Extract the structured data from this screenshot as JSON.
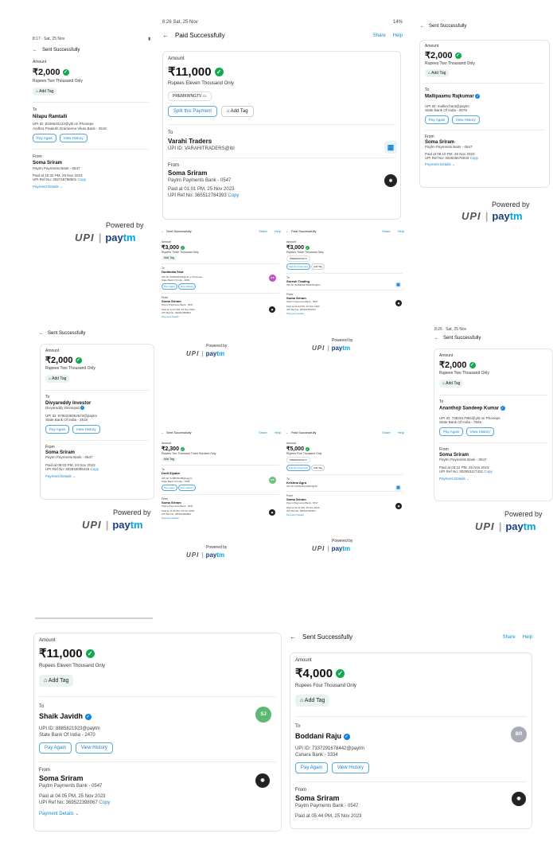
{
  "common": {
    "amount_label": "Amount",
    "to_label": "To",
    "from_label": "From",
    "add_tag": "Add Tag",
    "pay_again": "Pay Again",
    "view_history": "View History",
    "payment_details": "Payment Details",
    "share": "Share",
    "help": "Help",
    "sent_title": "Sent Successfully",
    "paid_title": "Paid Successfully",
    "powered_by": "Powered by",
    "upi": "UPI",
    "paytm_a": "pay",
    "paytm_b": "tm",
    "from_name": "Soma Sriram",
    "from_bank": "Paytm Payments Bank - 0547",
    "copy": "Copy"
  },
  "s1": {
    "status": "8:17 · Sat, 25 Nov",
    "amount": "₹2,000",
    "words": "Rupees Two Thousand Only",
    "to_name": "Nilapu Ramtalli",
    "upi": "UPI ID: 8106633123@ybl on Phonepe",
    "bank": "Andhra Pradesh Grameena Vikas Bank - 2518",
    "paid_at": "Paid at 10:32 PM, 25 Nov 2023",
    "ref": "UPI Ref No: 302748798501"
  },
  "s2": {
    "status_time": "8:26 Sat, 25 Nov",
    "status_right": "14%",
    "amount": "₹11,000",
    "words": "Rupees Eleven Thousand Only",
    "code": "PREMKWNGTV",
    "split": "Split this Payment",
    "to_name": "Varahi Traders",
    "upi": "UPI ID: VARAHITRADERS@ibl",
    "paid_at": "Paid at 01:01 PM, 25 Nov 2023",
    "ref": "UPI Ref No: 365512784393"
  },
  "s3": {
    "amount": "₹2,000",
    "words": "Rupees Two Thousand Only",
    "to_name": "Mallipaamu Rajkumar",
    "upi": "UPI ID: mallerchant@paytm",
    "bank": "State Bank Of India - 8078",
    "paid_at": "Paid at 08:10 PM, 25 Nov 2023",
    "ref": "UPI Ref No: 302846676033"
  },
  "s4": {
    "amount": "₹3,000",
    "words": "Rupees Three Thousand Only",
    "to_name": "Dudimala Siva",
    "av": "DS",
    "upi": "UPI ID: 6303845416@ybl on Phonepe",
    "bank": "State Bank Of India - 4830",
    "paid_at": "Paid at 12:27 PM, 25 Nov 2023",
    "ref": "UPI Ref No: 330921056804"
  },
  "s5": {
    "amount": "₹3,000",
    "words": "Rupees Three Thousand Only",
    "code": "PREMKWNGTV",
    "split": "Split this Payment",
    "to_name": "Suresh Trading",
    "upi": "UPI ID: SURESHTRADING@ibl",
    "paid_at": "Paid at 01:04 PM, 25 Nov 2023",
    "ref": "UPI Ref No: 365512784512"
  },
  "s6": {
    "amount": "₹2,000",
    "words": "Rupees Two Thousand Only",
    "to_name": "Divyareddy Investor",
    "sub_name": "Divyareddy Dinnepati",
    "upi": "UPI ID: 8796338452674@paytm",
    "bank": "State Bank Of India - 2518",
    "paid_at": "Paid at 09:03 PM, 24 Nov 2023",
    "ref": "UPI Ref No: 302840086426"
  },
  "s7": {
    "status": "8:26 · Sat, 25 Nov",
    "amount": "₹2,000",
    "words": "Rupees Two Thousand Only",
    "to_name": "Ananthoji Sandeep Kumar",
    "upi": "UPI ID: 7382017984@ybl on Phonepe",
    "bank": "State Bank Of India - 7645",
    "paid_at": "Paid at 03:22 PM, 25 Nov 2023",
    "ref": "UPI Ref No: 302953117422"
  },
  "s8": {
    "amount": "₹2,300",
    "words": "Rupees Two Thousand Three Hundred Only",
    "to_name": "Dodi Siyaka",
    "av": "DS",
    "upi": "UPI ID: 9798645189@paytm",
    "bank": "State Bank Of India - 7618",
    "paid_at": "Paid at 11:09 AM, 25 Nov 2023",
    "ref": "UPI Ref No: 365512099864"
  },
  "s9": {
    "amount": "₹5,000",
    "words": "Rupees Five Thousand Only",
    "code": "PREMKWNGTV",
    "split": "Split this Payment",
    "to_name": "Krishna Agro",
    "upi": "UPI ID: KRISHNAAGRO@ibl",
    "paid_at": "Paid at 02:11 PM, 25 Nov 2023",
    "ref": "UPI Ref No: 365512785601"
  },
  "s10": {
    "amount": "₹11,000",
    "words": "Rupees Eleven Thousand Only",
    "to_name": "Shaik Javidh",
    "av": "SJ",
    "upi": "UPI ID: 8885821923@paytm",
    "bank": "State Bank Of India - 2470",
    "paid_at": "Paid at 04:05 PM, 25 Nov 2023",
    "ref": "UPI Ref No: 369522398067"
  },
  "s11": {
    "amount": "₹4,000",
    "words": "Rupees Four Thousand Only",
    "to_name": "Boddani Raju",
    "av": "BR",
    "upi": "UPI ID: 7337291678442@paytm",
    "bank": "Canara Bank - 3334",
    "paid_at": "Paid at 05:44 PM, 25 Nov 2023"
  },
  "colors": {
    "accent": "#1a86d0",
    "check": "#12a84e",
    "verified": "#1282e0"
  }
}
